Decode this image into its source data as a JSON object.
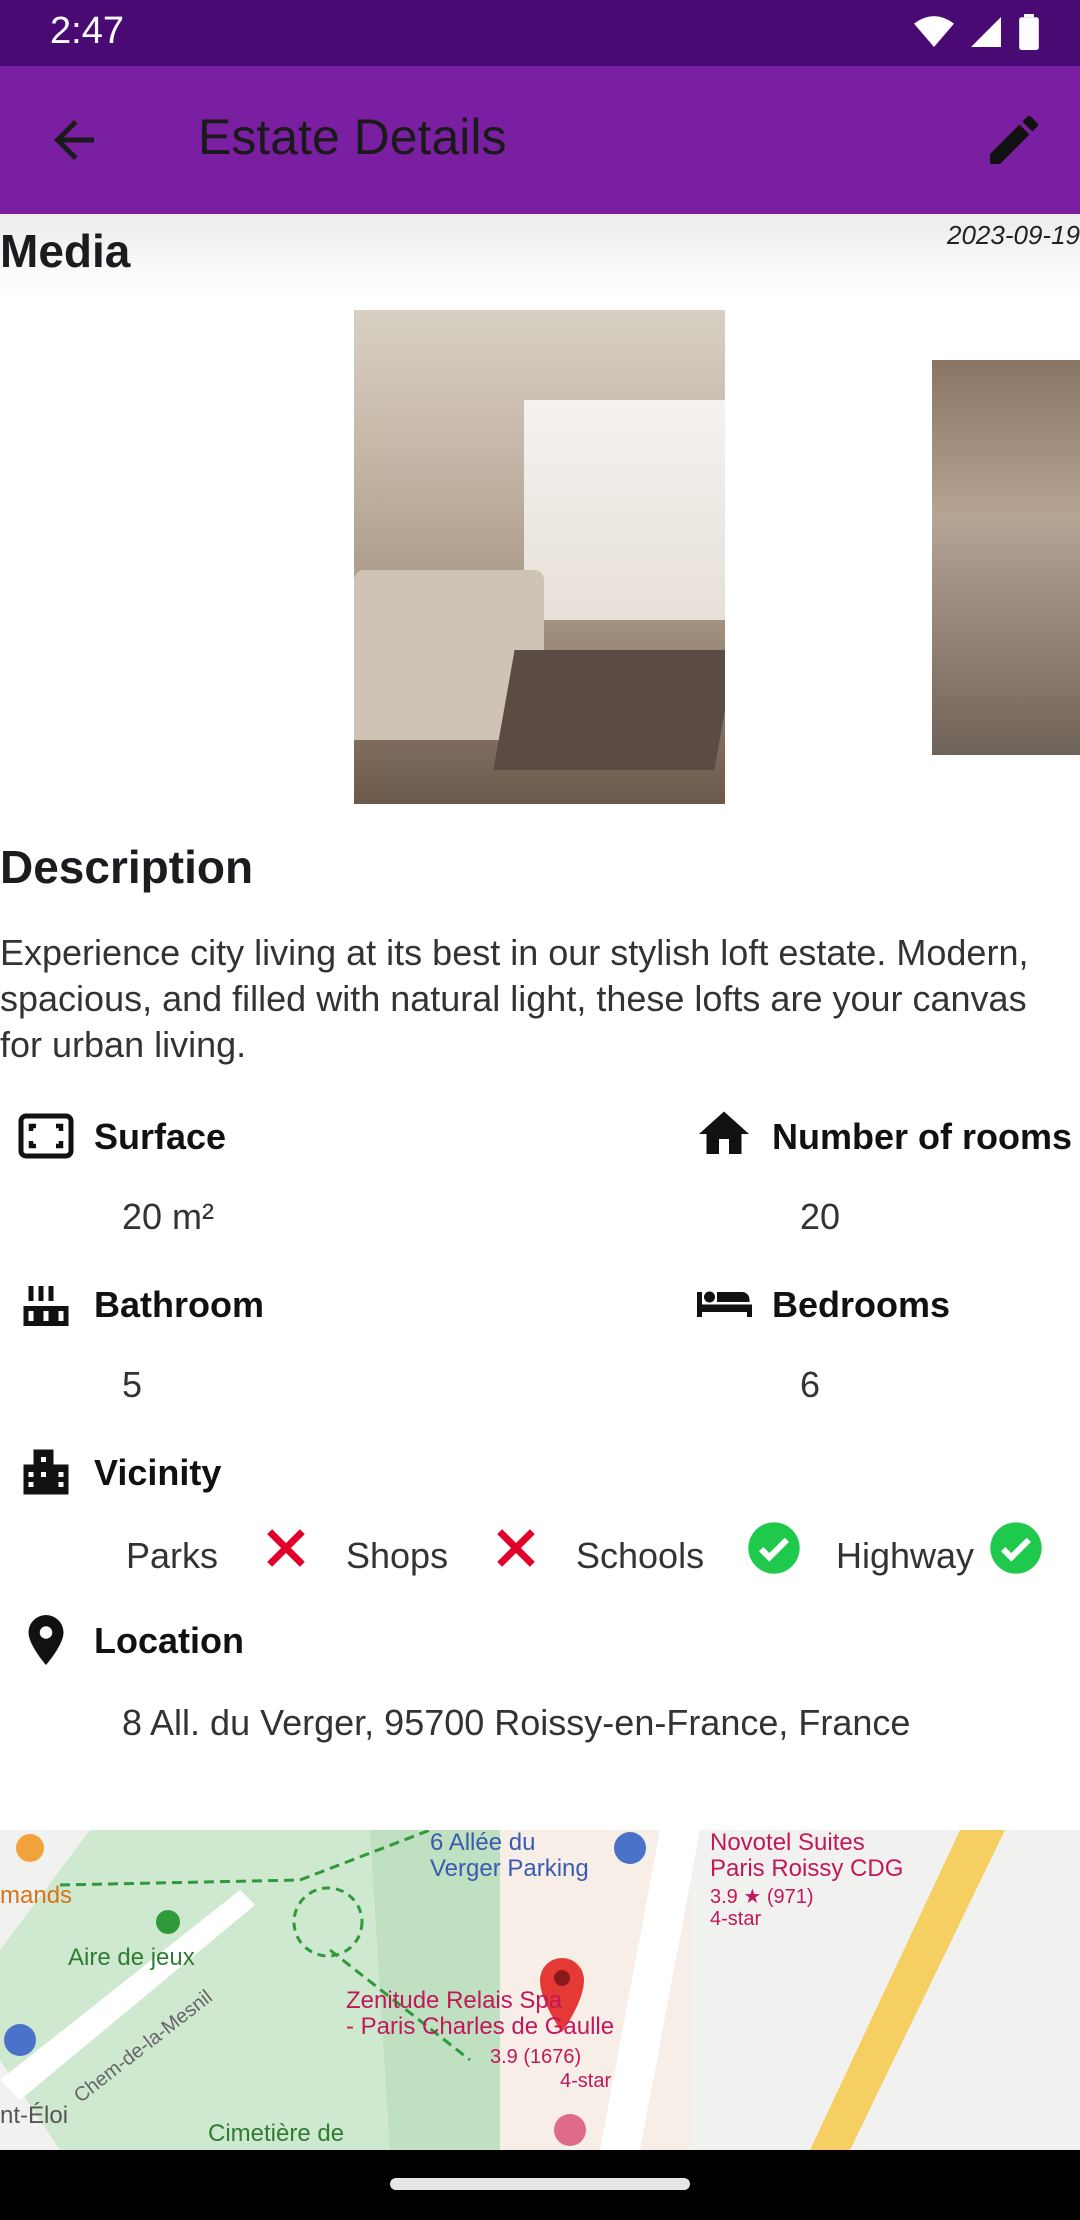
{
  "status": {
    "time": "2:47"
  },
  "appbar": {
    "title": "Estate Details"
  },
  "media": {
    "heading": "Media",
    "date": "2023-09-19"
  },
  "description": {
    "heading": "Description",
    "text": "Experience city living at its best in our stylish loft estate. Modern, spacious, and filled with natural light, these lofts are your canvas for urban living."
  },
  "features": {
    "surface": {
      "label": "Surface",
      "value": "20 m²"
    },
    "rooms": {
      "label": "Number of rooms",
      "value": "20"
    },
    "bathroom": {
      "label": "Bathroom",
      "value": "5"
    },
    "bedrooms": {
      "label": "Bedrooms",
      "value": "6"
    }
  },
  "vicinity": {
    "label": "Vicinity",
    "items": [
      {
        "name": "Parks",
        "available": false
      },
      {
        "name": "Shops",
        "available": false
      },
      {
        "name": "Schools",
        "available": true
      },
      {
        "name": "Highway",
        "available": true
      }
    ]
  },
  "location": {
    "label": "Location",
    "address": "8 All. du Verger, 95700 Roissy-en-France, France"
  },
  "map": {
    "labels": {
      "parking": "6 Allée du\nVerger Parking",
      "novotel": "Novotel Suites\nParis Roissy CDG",
      "novotel_rating": "3.9 ★ (971)",
      "novotel_class": "4-star",
      "park": "Aire de jeux",
      "hotel": "Zenitude Relais Spa\n- Paris Charles de Gaulle",
      "hotel_rating": "3.9 (1676)",
      "hotel_class": "4-star",
      "street": "Chem-de-la-Mesnil",
      "cemetery": "Cimetière de",
      "left1": "mands",
      "left2": "nt-Éloi"
    }
  },
  "colors": {
    "primary": "#7b1fa2",
    "statusbar": "#4a0a73",
    "no": "#e0002a",
    "yes": "#1ec94b"
  }
}
